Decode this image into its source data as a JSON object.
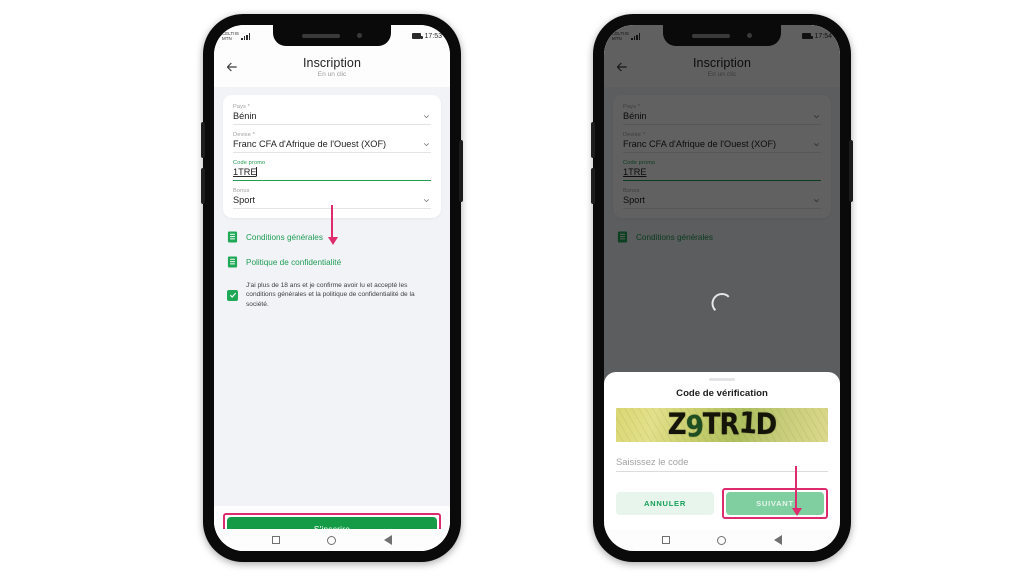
{
  "phones": {
    "left": {
      "status": {
        "carrier_line1": "CELTIIS",
        "carrier_line2": "MTN",
        "clock": "17:53"
      },
      "header": {
        "title": "Inscription",
        "subtitle": "En un clic",
        "back_icon": "back-arrow-icon"
      },
      "form": {
        "fields": [
          {
            "label": "Pays *",
            "value": "Bénin",
            "type": "select"
          },
          {
            "label": "Devise *",
            "value": "Franc CFA d'Afrique de l'Ouest (XOF)",
            "type": "select"
          },
          {
            "label": "Code promo",
            "value": "1TRE",
            "type": "text"
          },
          {
            "label": "Bonus",
            "value": "Sport",
            "type": "select"
          }
        ]
      },
      "links": [
        {
          "label": "Conditions générales",
          "icon": "document-icon"
        },
        {
          "label": "Politique de confidentialité",
          "icon": "document-icon"
        }
      ],
      "consent": {
        "text": "J'ai plus de 18 ans et je confirme avoir lu et accepté les conditions générales et la politique de confidentialité de la société.",
        "checked": true
      },
      "cta": {
        "label": "S'inscrire"
      },
      "navbar": {
        "recent": "square-icon",
        "home": "circle-icon",
        "back": "triangle-icon"
      }
    },
    "right": {
      "status": {
        "carrier_line1": "CELTIIS",
        "carrier_line2": "MTN",
        "clock": "17:54"
      },
      "header": {
        "title": "Inscription",
        "subtitle": "En un clic",
        "back_icon": "back-arrow-icon"
      },
      "form": {
        "fields": [
          {
            "label": "Pays *",
            "value": "Bénin",
            "type": "select"
          },
          {
            "label": "Devise *",
            "value": "Franc CFA d'Afrique de l'Ouest (XOF)",
            "type": "select"
          },
          {
            "label": "Code promo",
            "value": "1TRE",
            "type": "text"
          },
          {
            "label": "Bonus",
            "value": "Sport",
            "type": "select"
          }
        ]
      },
      "links": [
        {
          "label": "Conditions générales",
          "icon": "document-icon"
        }
      ],
      "dialog": {
        "title": "Code de vérification",
        "captcha_text": "Z9TR1D",
        "input_placeholder": "Saisissez le code",
        "cancel_label": "ANNULER",
        "next_label": "SUIVANT"
      },
      "navbar": {
        "recent": "square-icon",
        "home": "circle-icon",
        "back": "triangle-icon"
      }
    }
  },
  "annotations": {
    "arrow_color": "#de2b6d",
    "highlight_color": "#de2b6d"
  },
  "colors": {
    "brand_green": "#159b45",
    "accent_green": "#1f9d55",
    "pink": "#de2b6d",
    "screen_bg": "#f2f3f7"
  }
}
